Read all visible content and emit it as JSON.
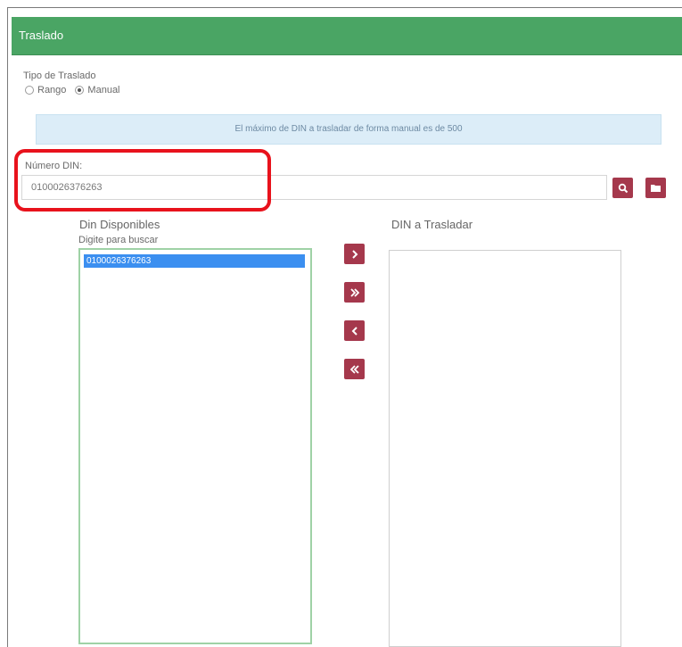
{
  "panel": {
    "title": "Traslado"
  },
  "transfer_type": {
    "label": "Tipo de Traslado",
    "options": [
      {
        "label": "Rango",
        "selected": false
      },
      {
        "label": "Manual",
        "selected": true
      }
    ]
  },
  "info_message": "El máximo de DIN a trasladar de forma manual es de 500",
  "din_field": {
    "label": "Número DIN:",
    "value": "0100026376263"
  },
  "available": {
    "title": "Din Disponibles",
    "search_hint": "Digite para buscar",
    "items": [
      "0100026376263"
    ]
  },
  "to_transfer": {
    "title": "DIN a Trasladar",
    "items": []
  },
  "colors": {
    "header": "#4aa564",
    "button": "#a5384c",
    "selected_item": "#3b8ff0",
    "highlight": "#e8121c"
  },
  "icons": {
    "search": "search-icon",
    "folder": "folder-icon",
    "move_one_right": "chevron-right-icon",
    "move_all_right": "double-chevron-right-icon",
    "move_one_left": "chevron-left-icon",
    "move_all_left": "double-chevron-left-icon"
  }
}
